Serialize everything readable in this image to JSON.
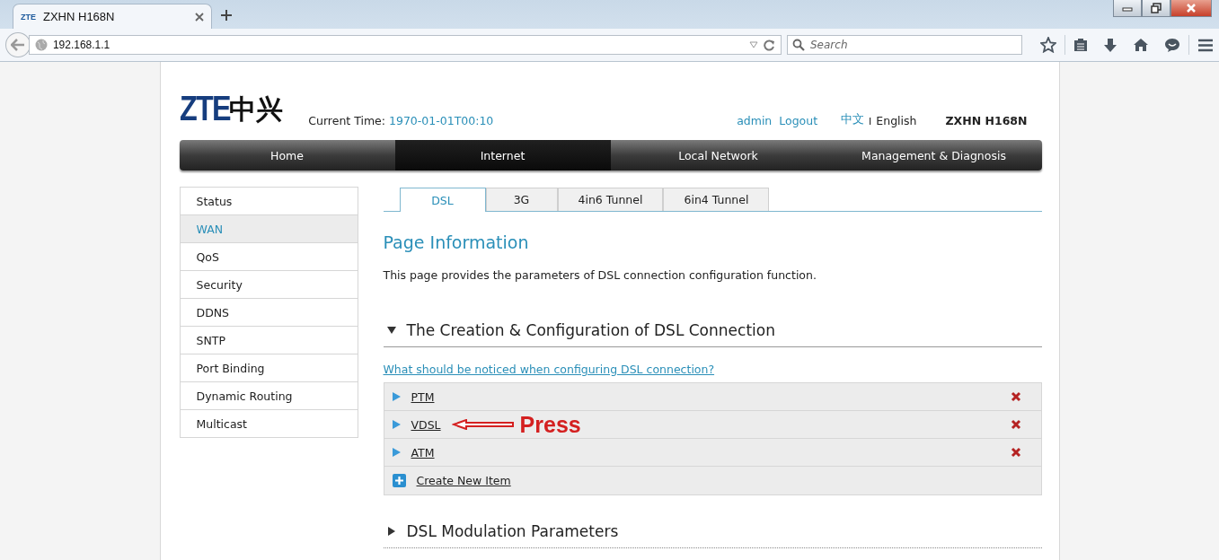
{
  "browser": {
    "tab": {
      "favicon_text": "ZTE",
      "title": "ZXHN H168N"
    },
    "address": "192.168.1.1",
    "search": {
      "placeholder": "Search"
    }
  },
  "header": {
    "logo": {
      "latin": "ZTE",
      "cjk": "中兴"
    },
    "time_label": "Current Time:",
    "time_value": "1970-01-01T00:10",
    "user": "admin",
    "logout": "Logout",
    "languages": [
      {
        "label": "中文",
        "selected": false
      },
      {
        "label": "English",
        "selected": true
      }
    ],
    "separator": "I",
    "model": "ZXHN H168N"
  },
  "nav": [
    {
      "label": "Home",
      "selected": false
    },
    {
      "label": "Internet",
      "selected": true
    },
    {
      "label": "Local Network",
      "selected": false
    },
    {
      "label": "Management & Diagnosis",
      "selected": false
    }
  ],
  "sidebar": {
    "items": [
      {
        "label": "Status",
        "selected": false
      },
      {
        "label": "WAN",
        "selected": true
      },
      {
        "label": "QoS",
        "selected": false
      },
      {
        "label": "Security",
        "selected": false
      },
      {
        "label": "DDNS",
        "selected": false
      },
      {
        "label": "SNTP",
        "selected": false
      },
      {
        "label": "Port Binding",
        "selected": false
      },
      {
        "label": "Dynamic Routing",
        "selected": false
      },
      {
        "label": "Multicast",
        "selected": false
      }
    ]
  },
  "tabs": [
    {
      "label": "DSL",
      "selected": true
    },
    {
      "label": "3G",
      "selected": false
    },
    {
      "label": "4in6 Tunnel",
      "selected": false
    },
    {
      "label": "6in4 Tunnel",
      "selected": false
    }
  ],
  "page_info": {
    "title": "Page Information",
    "description": "This page provides the parameters of DSL connection configuration function."
  },
  "sections": [
    {
      "title": "The Creation & Configuration of DSL Connection",
      "expanded": true,
      "help_link": "What should be noticed when configuring DSL connection?",
      "items": [
        {
          "label": "PTM"
        },
        {
          "label": "VDSL",
          "annotation": "Press"
        },
        {
          "label": "ATM"
        }
      ],
      "create_label": "Create New Item"
    },
    {
      "title": "DSL Modulation Parameters",
      "expanded": false
    }
  ]
}
